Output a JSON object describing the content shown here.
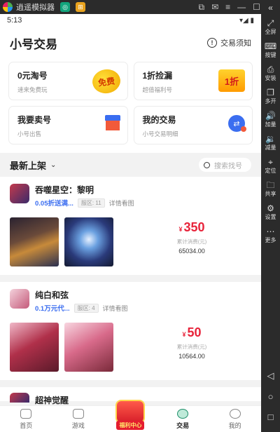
{
  "emulator": {
    "title": "逍遥模拟器",
    "window_controls": [
      "restore-icon",
      "mail-icon",
      "menu-icon",
      "minimize-icon",
      "maximize-icon",
      "close-icon"
    ],
    "side_top": "«",
    "side_items": [
      {
        "icon": "⤢",
        "label": "全屏"
      },
      {
        "icon": "⌨",
        "label": "按键"
      },
      {
        "icon": "⎙",
        "label": "安装"
      },
      {
        "icon": "❐",
        "label": "多开"
      },
      {
        "icon": "🔊",
        "label": "加量"
      },
      {
        "icon": "🔉",
        "label": "减量"
      },
      {
        "icon": "⌖",
        "label": "定位"
      },
      {
        "icon": "🗀",
        "label": "共享"
      },
      {
        "icon": "⚙",
        "label": "设置"
      },
      {
        "icon": "⋯",
        "label": "更多"
      }
    ],
    "nav_buttons": [
      "◁",
      "○",
      "□"
    ]
  },
  "status": {
    "time": "5:13",
    "icons": "▾◢ ▮"
  },
  "header": {
    "title": "小号交易",
    "notice_label": "交易须知",
    "notice_icon": "!"
  },
  "cards": [
    {
      "title": "0元淘号",
      "subtitle": "速来免费玩",
      "art": "免费"
    },
    {
      "title": "1折捡漏",
      "subtitle": "超值福利号",
      "art": "1折"
    },
    {
      "title": "我要卖号",
      "subtitle": "小号出售",
      "art": ""
    },
    {
      "title": "我的交易",
      "subtitle": "小号交易明细",
      "art": "⇄"
    }
  ],
  "section": {
    "title": "最新上架",
    "chevron": "⌄",
    "search_placeholder": "搜索找号"
  },
  "listings": [
    {
      "name": "吞噬星空：黎明",
      "tag": "0.05折送满...",
      "zone": "服区: 11",
      "more": "详情看图",
      "currency": "¥",
      "price": "350",
      "spent_label": "累计消费(元)",
      "spent": "65034.00"
    },
    {
      "name": "纯白和弦",
      "tag": "0.1万元代...",
      "zone": "服区: 4",
      "more": "详情看图",
      "currency": "¥",
      "price": "50",
      "spent_label": "累计消费(元)",
      "spent": "10564.00"
    },
    {
      "name": "超神觉醒"
    }
  ],
  "tabbar": [
    {
      "label": "首页"
    },
    {
      "label": "游戏"
    },
    {
      "label": "福利中心"
    },
    {
      "label": "交易"
    },
    {
      "label": "我的"
    }
  ],
  "colors": {
    "accent_blue": "#3a6df0",
    "price_red": "#e8233a",
    "trade_green": "#1f8f6a"
  }
}
